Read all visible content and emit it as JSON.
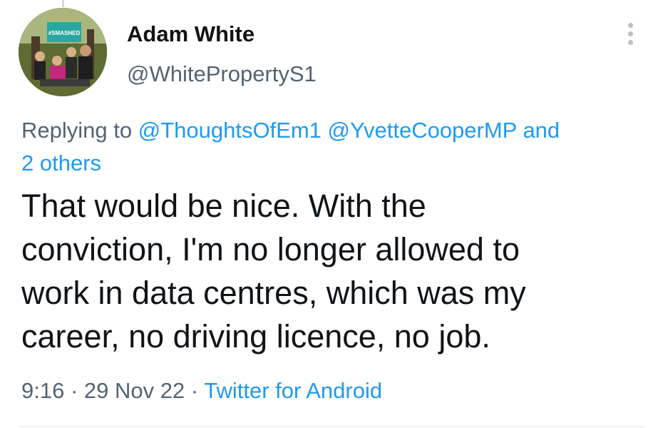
{
  "tweet": {
    "author_name": "Adam White",
    "author_handle": "@WhitePropertyS1",
    "avatar_sign_text": "#SMASHED",
    "replying_prefix": "Replying to",
    "mention_1": "@ThoughtsOfEm1",
    "mention_2": "@YvetteCooperMP",
    "mention_and": "and",
    "mention_others": "2 others",
    "text_lines": [
      "That would be nice. With the",
      "conviction, I'm no longer allowed to",
      "work in data centres, which was my",
      "career, no driving licence, no job."
    ],
    "time": "9:16",
    "separator": "·",
    "date": "29 Nov 22",
    "source": "Twitter for Android"
  },
  "colors": {
    "link": "#1d9bf0",
    "secondary_text": "#536471",
    "primary_text": "#0f1419"
  },
  "icons": {
    "more": "more-vertical-icon"
  }
}
